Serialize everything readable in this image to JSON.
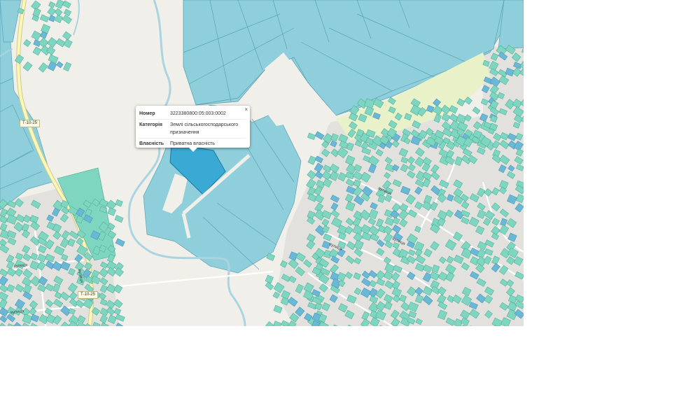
{
  "popup": {
    "rows": [
      {
        "label": "Номер",
        "value": "3223380800:05:003:0002"
      },
      {
        "label": "Категорія",
        "value": "Землі сільськогосподарського призначення"
      },
      {
        "label": "Власність",
        "value": "Приватна власність"
      }
    ],
    "close_label": "×"
  },
  "road_shields": [
    "Т-10-25",
    "Т-10-25"
  ],
  "colors": {
    "land": "#f1efe9",
    "agricultural_parcel": "#8ecfdc",
    "agricultural_parcel_dark": "#7fc4d3",
    "residential_parcel": "#7ed6c1",
    "selected_parcel": "#3aa9d4",
    "river": "#aad3df",
    "main_road": "#fbf7b6",
    "built_up_area": "#e0e0dd"
  },
  "icons": {
    "close": "close-icon"
  }
}
